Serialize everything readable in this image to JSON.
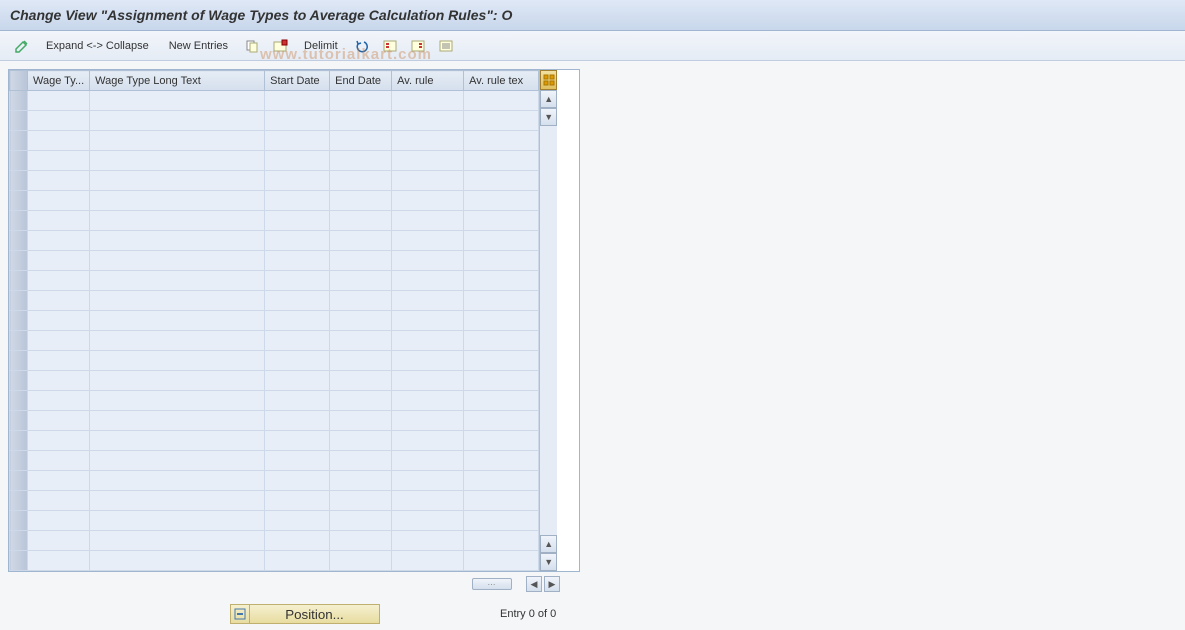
{
  "header": {
    "title": "Change View \"Assignment of Wage Types to Average Calculation Rules\": O"
  },
  "toolbar": {
    "expand_collapse": "Expand <-> Collapse",
    "new_entries": "New Entries",
    "delimit": "Delimit"
  },
  "table": {
    "columns": {
      "wage_type": "Wage Ty...",
      "wage_long": "Wage Type Long Text",
      "start_date": "Start Date",
      "end_date": "End Date",
      "av_rule": "Av. rule",
      "av_rule_text": "Av. rule tex"
    },
    "row_count": 24
  },
  "footer": {
    "position": "Position...",
    "entry": "Entry 0 of 0"
  },
  "watermark": "www.tutorialkart.com"
}
